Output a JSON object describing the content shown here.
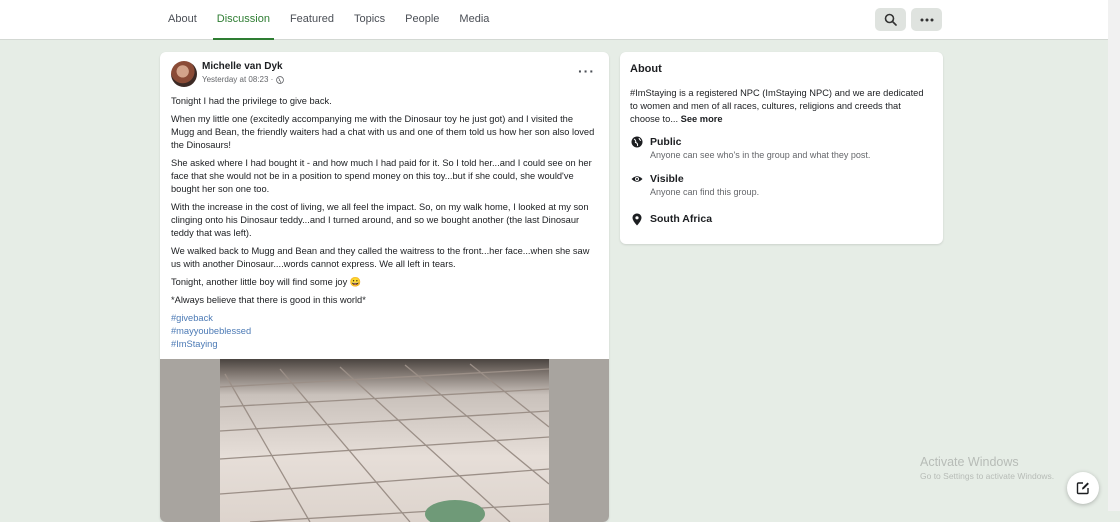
{
  "nav": {
    "tabs": [
      {
        "label": "About"
      },
      {
        "label": "Discussion"
      },
      {
        "label": "Featured"
      },
      {
        "label": "Topics"
      },
      {
        "label": "People"
      },
      {
        "label": "Media"
      }
    ],
    "active_tab": "Discussion",
    "search_icon": "search-icon",
    "more_icon": "more-horizontal-icon"
  },
  "post": {
    "author": "Michelle van Dyk",
    "timestamp": "Yesterday at 08:23 ·",
    "privacy_icon": "globe-icon",
    "paragraphs": [
      "Tonight I had the privilege to give back.",
      "When my little one (excitedly accompanying me with the Dinosaur toy he just got) and I visited the Mugg and Bean, the friendly waiters had a chat with us and one of them told us how her son also loved the Dinosaurs!",
      "She asked where I had bought it - and how much I had paid for it. So I told her...and I could see on her face that she would not be in a position to spend money on this toy...but if she could, she would've bought her son one too.",
      "With the increase in the cost of living, we all feel the impact. So, on my walk home, I looked at my son clinging onto his Dinosaur teddy...and I turned around, and so we bought another (the last Dinosaur teddy that was left).",
      "We walked back to Mugg and Bean and they called the waitress to the front...her face...when she saw us with another Dinosaur....words cannot express. We all left in tears.",
      "Tonight, another little boy will find some joy 😀",
      "*Always believe that there is good in this world*"
    ],
    "hashtags": [
      "#giveback",
      "#mayyoubeblessed",
      "#ImStaying"
    ]
  },
  "about": {
    "title": "About",
    "description": "#ImStaying is a registered NPC (ImStaying NPC) and we are dedicated to women and men of all races, cultures, religions and creeds that choose to...",
    "see_more": "See more",
    "public_title": "Public",
    "public_sub": "Anyone can see who's in the group and what they post.",
    "visible_title": "Visible",
    "visible_sub": "Anyone can find this group.",
    "location": "South Africa"
  },
  "watermark": {
    "line1": "Activate Windows",
    "line2": "Go to Settings to activate Windows."
  },
  "colors": {
    "accent": "#2e7d32",
    "background": "#e6ede6",
    "hashtag": "#4c7ab5"
  }
}
